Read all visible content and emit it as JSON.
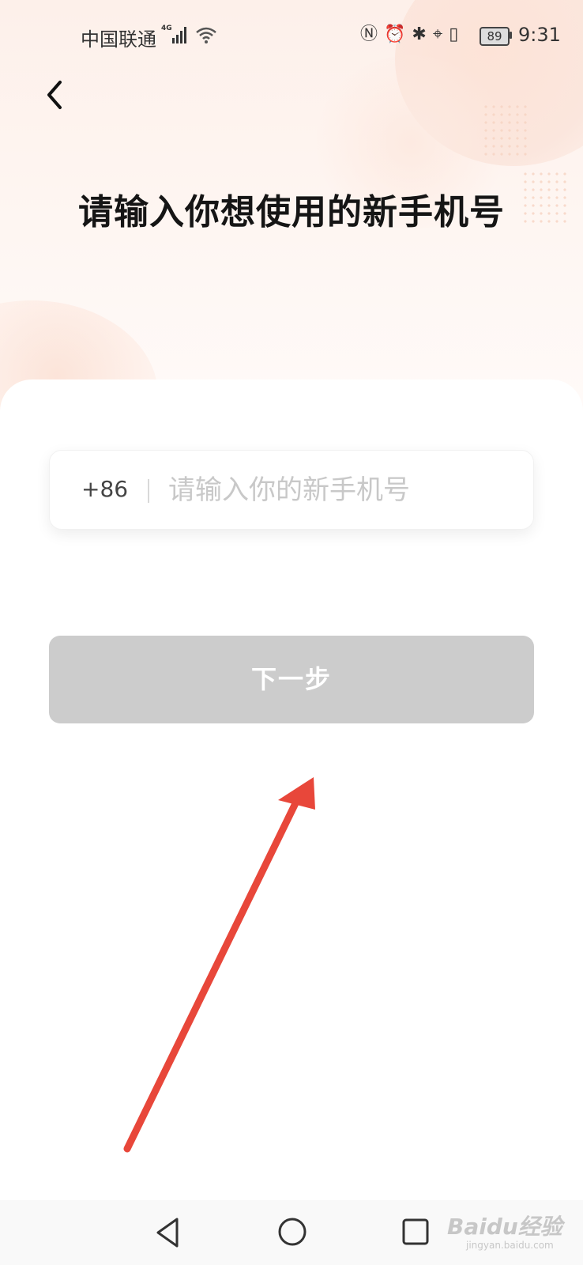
{
  "status_bar": {
    "carrier": "中国联通",
    "network_type": "4G",
    "icons": [
      "nfc-icon",
      "alarm-icon",
      "bluetooth-icon",
      "location-icon",
      "vibrate-icon"
    ],
    "battery": "89",
    "time": "9:31"
  },
  "header": {
    "back_icon": "chevron-left-icon"
  },
  "page": {
    "title": "请输入你想使用的新手机号"
  },
  "phone_form": {
    "country_code": "+86",
    "placeholder": "请输入你的新手机号",
    "value": ""
  },
  "actions": {
    "next_label": "下一步",
    "next_enabled": false,
    "disabled_color": "#cccccc"
  },
  "annotation": {
    "arrow_color": "#e8473a"
  },
  "nav_bar": {
    "icons": [
      "triangle-back-icon",
      "circle-home-icon",
      "square-recent-icon"
    ]
  },
  "watermark": {
    "text": "Baidu经验",
    "sub": "jingyan.baidu.com"
  },
  "colors": {
    "background_top": "#fdf0ea",
    "title": "#151515",
    "placeholder": "#c8c8c8"
  }
}
